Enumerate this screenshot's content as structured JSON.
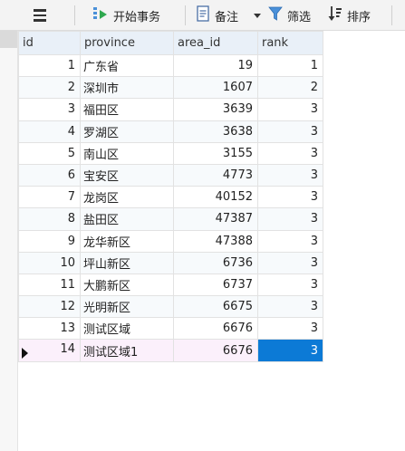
{
  "toolbar": {
    "begin_transaction": "开始事务",
    "memo": "备注",
    "filter": "筛选",
    "sort": "排序",
    "icons": [
      "menu-icon",
      "transaction-icon",
      "memo-icon",
      "dropdown-icon",
      "filter-icon",
      "sort-icon"
    ]
  },
  "table": {
    "columns": [
      "id",
      "province",
      "area_id",
      "rank"
    ],
    "rows": [
      {
        "id": "1",
        "province": "广东省",
        "area_id": "19",
        "rank": "1"
      },
      {
        "id": "2",
        "province": "深圳市",
        "area_id": "1607",
        "rank": "2"
      },
      {
        "id": "3",
        "province": "福田区",
        "area_id": "3639",
        "rank": "3"
      },
      {
        "id": "4",
        "province": "罗湖区",
        "area_id": "3638",
        "rank": "3"
      },
      {
        "id": "5",
        "province": "南山区",
        "area_id": "3155",
        "rank": "3"
      },
      {
        "id": "6",
        "province": "宝安区",
        "area_id": "4773",
        "rank": "3"
      },
      {
        "id": "7",
        "province": "龙岗区",
        "area_id": "40152",
        "rank": "3"
      },
      {
        "id": "8",
        "province": "盐田区",
        "area_id": "47387",
        "rank": "3"
      },
      {
        "id": "9",
        "province": "龙华新区",
        "area_id": "47388",
        "rank": "3"
      },
      {
        "id": "10",
        "province": "坪山新区",
        "area_id": "6736",
        "rank": "3"
      },
      {
        "id": "11",
        "province": "大鹏新区",
        "area_id": "6737",
        "rank": "3"
      },
      {
        "id": "12",
        "province": "光明新区",
        "area_id": "6675",
        "rank": "3"
      },
      {
        "id": "13",
        "province": "测试区域",
        "area_id": "6676",
        "rank": "3"
      },
      {
        "id": "14",
        "province": "测试区域1",
        "area_id": "6676",
        "rank": "3"
      }
    ]
  },
  "colors": {
    "header_bg": "#e9f0f8",
    "selected_cell": "#0c7ad6",
    "current_row": "#fbf0fb"
  }
}
